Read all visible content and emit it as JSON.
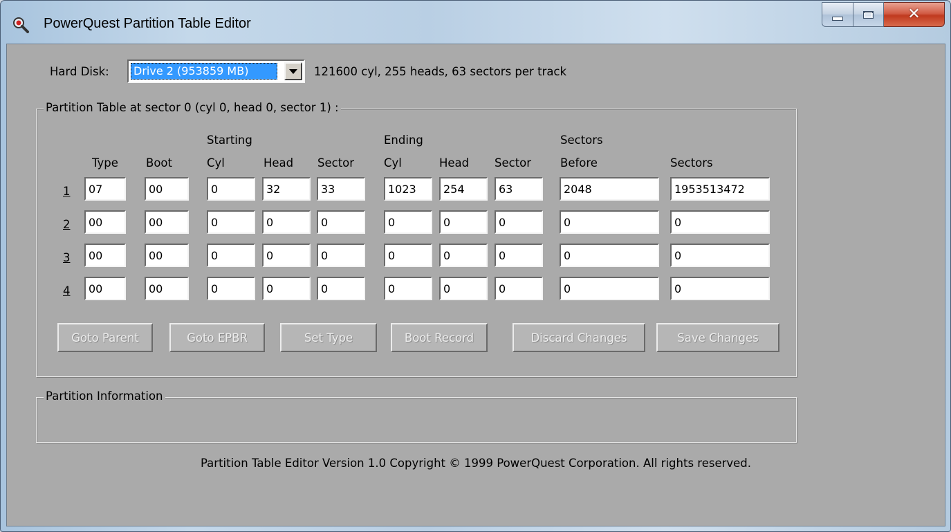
{
  "window": {
    "title": "PowerQuest Partition Table Editor",
    "icon": "magnifier-icon",
    "controls": [
      "minimize-icon",
      "maximize-icon",
      "close-icon"
    ]
  },
  "disk": {
    "label": "Hard Disk:",
    "selected": "Drive 2 (953859 MB)",
    "geometry": "121600 cyl, 255 heads, 63 sectors per track"
  },
  "table": {
    "group_title": "Partition Table at sector 0 (cyl 0, head 0, sector 1) :",
    "group_headers": {
      "starting": "Starting",
      "ending": "Ending",
      "sectors": "Sectors"
    },
    "columns": [
      "Type",
      "Boot",
      "Cyl",
      "Head",
      "Sector",
      "Cyl",
      "Head",
      "Sector",
      "Before",
      "Sectors"
    ],
    "rows": [
      {
        "num": "1",
        "values": [
          "07",
          "00",
          "0",
          "32",
          "33",
          "1023",
          "254",
          "63",
          "2048",
          "1953513472"
        ]
      },
      {
        "num": "2",
        "values": [
          "00",
          "00",
          "0",
          "0",
          "0",
          "0",
          "0",
          "0",
          "0",
          "0"
        ]
      },
      {
        "num": "3",
        "values": [
          "00",
          "00",
          "0",
          "0",
          "0",
          "0",
          "0",
          "0",
          "0",
          "0"
        ]
      },
      {
        "num": "4",
        "values": [
          "00",
          "00",
          "0",
          "0",
          "0",
          "0",
          "0",
          "0",
          "0",
          "0"
        ]
      }
    ]
  },
  "buttons": {
    "goto_parent": "Goto Parent",
    "goto_epbr": "Goto EPBR",
    "set_type": "Set Type",
    "boot_record": "Boot Record",
    "discard": "Discard Changes",
    "save": "Save Changes"
  },
  "info": {
    "group_title": "Partition Information"
  },
  "footer": "Partition Table Editor Version 1.0  Copyright © 1999 PowerQuest Corporation.  All rights reserved.",
  "colors": {
    "dialog_bg": "#aaaaaa",
    "selection": "#3399ff",
    "close_button": "#c8452c"
  }
}
